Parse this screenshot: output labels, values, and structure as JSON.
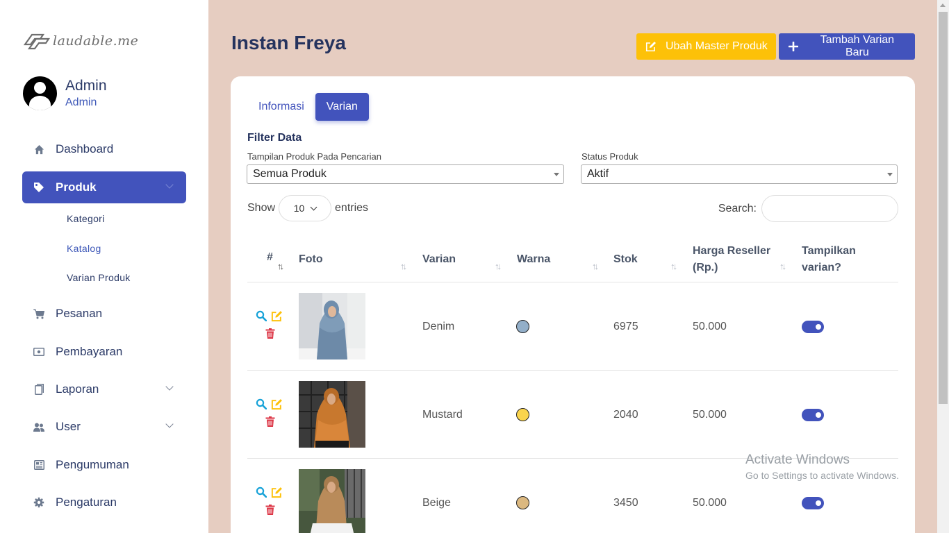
{
  "brand": {
    "logo_text": "laudable.me"
  },
  "profile": {
    "name": "Admin",
    "role": "Admin"
  },
  "sidebar": {
    "items": [
      {
        "label": "Dashboard",
        "icon": "home-icon"
      },
      {
        "label": "Produk",
        "icon": "tag-icon",
        "active": true
      },
      {
        "label": "Pesanan",
        "icon": "cart-icon"
      },
      {
        "label": "Pembayaran",
        "icon": "money-icon"
      },
      {
        "label": "Laporan",
        "icon": "file-icon"
      },
      {
        "label": "User",
        "icon": "users-icon"
      },
      {
        "label": "Pengumuman",
        "icon": "newspaper-icon"
      },
      {
        "label": "Pengaturan",
        "icon": "gear-icon"
      }
    ],
    "produk_submenu": [
      "Kategori",
      "Katalog",
      "Varian Produk"
    ]
  },
  "header": {
    "title": "Instan Freya",
    "edit_button": "Ubah Master Produk",
    "add_button": "Tambah Varian Baru"
  },
  "tabs": [
    "Informasi",
    "Varian"
  ],
  "filter": {
    "title": "Filter Data",
    "display_label": "Tampilan Produk Pada Pencarian",
    "display_value": "Semua Produk",
    "status_label": "Status Produk",
    "status_value": "Aktif"
  },
  "table_controls": {
    "show_label": "Show",
    "entries_value": "10",
    "entries_label": "entries",
    "search_label": "Search:"
  },
  "table": {
    "headers": {
      "no": "#",
      "photo": "Foto",
      "variant": "Varian",
      "color": "Warna",
      "stock": "Stok",
      "price_line1": "Harga Reseller",
      "price_line2": "(Rp.)",
      "show_line1": "Tampilkan",
      "show_line2": "varian?"
    },
    "rows": [
      {
        "variant": "Denim",
        "color": "#93afc9",
        "stock": "6975",
        "price": "50.000",
        "visible": true
      },
      {
        "variant": "Mustard",
        "color": "#fad44d",
        "stock": "2040",
        "price": "50.000",
        "visible": true
      },
      {
        "variant": "Beige",
        "color": "#dbb880",
        "stock": "3450",
        "price": "50.000",
        "visible": true
      }
    ]
  },
  "watermark": {
    "title": "Activate Windows",
    "subtitle": "Go to Settings to activate Windows."
  },
  "colors": {
    "primary": "#4253bc",
    "warning": "#fdc108",
    "danger": "#dc3545",
    "info": "#17a2d8",
    "background": "#e6cdc1"
  }
}
